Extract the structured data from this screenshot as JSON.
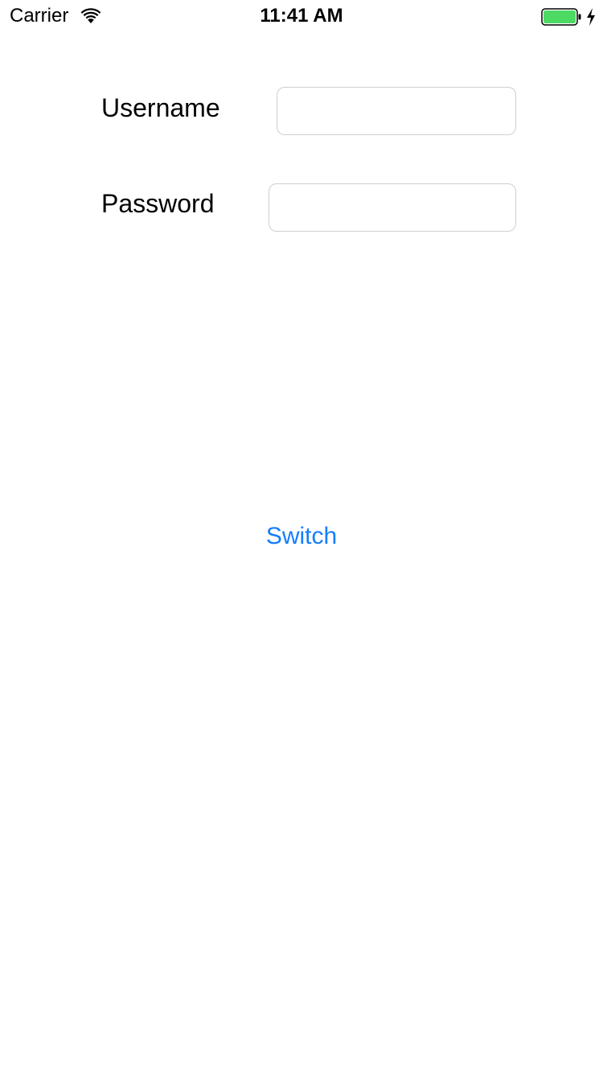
{
  "status_bar": {
    "carrier": "Carrier",
    "time": "11:41 AM",
    "wifi_icon": "wifi-icon",
    "battery_icon": "battery-icon",
    "charging_icon": "charging-bolt-icon",
    "battery_level": 1.0,
    "battery_color": "#4cd964"
  },
  "form": {
    "username": {
      "label": "Username",
      "value": "",
      "placeholder": ""
    },
    "password": {
      "label": "Password",
      "value": "",
      "placeholder": ""
    }
  },
  "actions": {
    "switch_label": "Switch",
    "accent_color": "#147efb"
  }
}
